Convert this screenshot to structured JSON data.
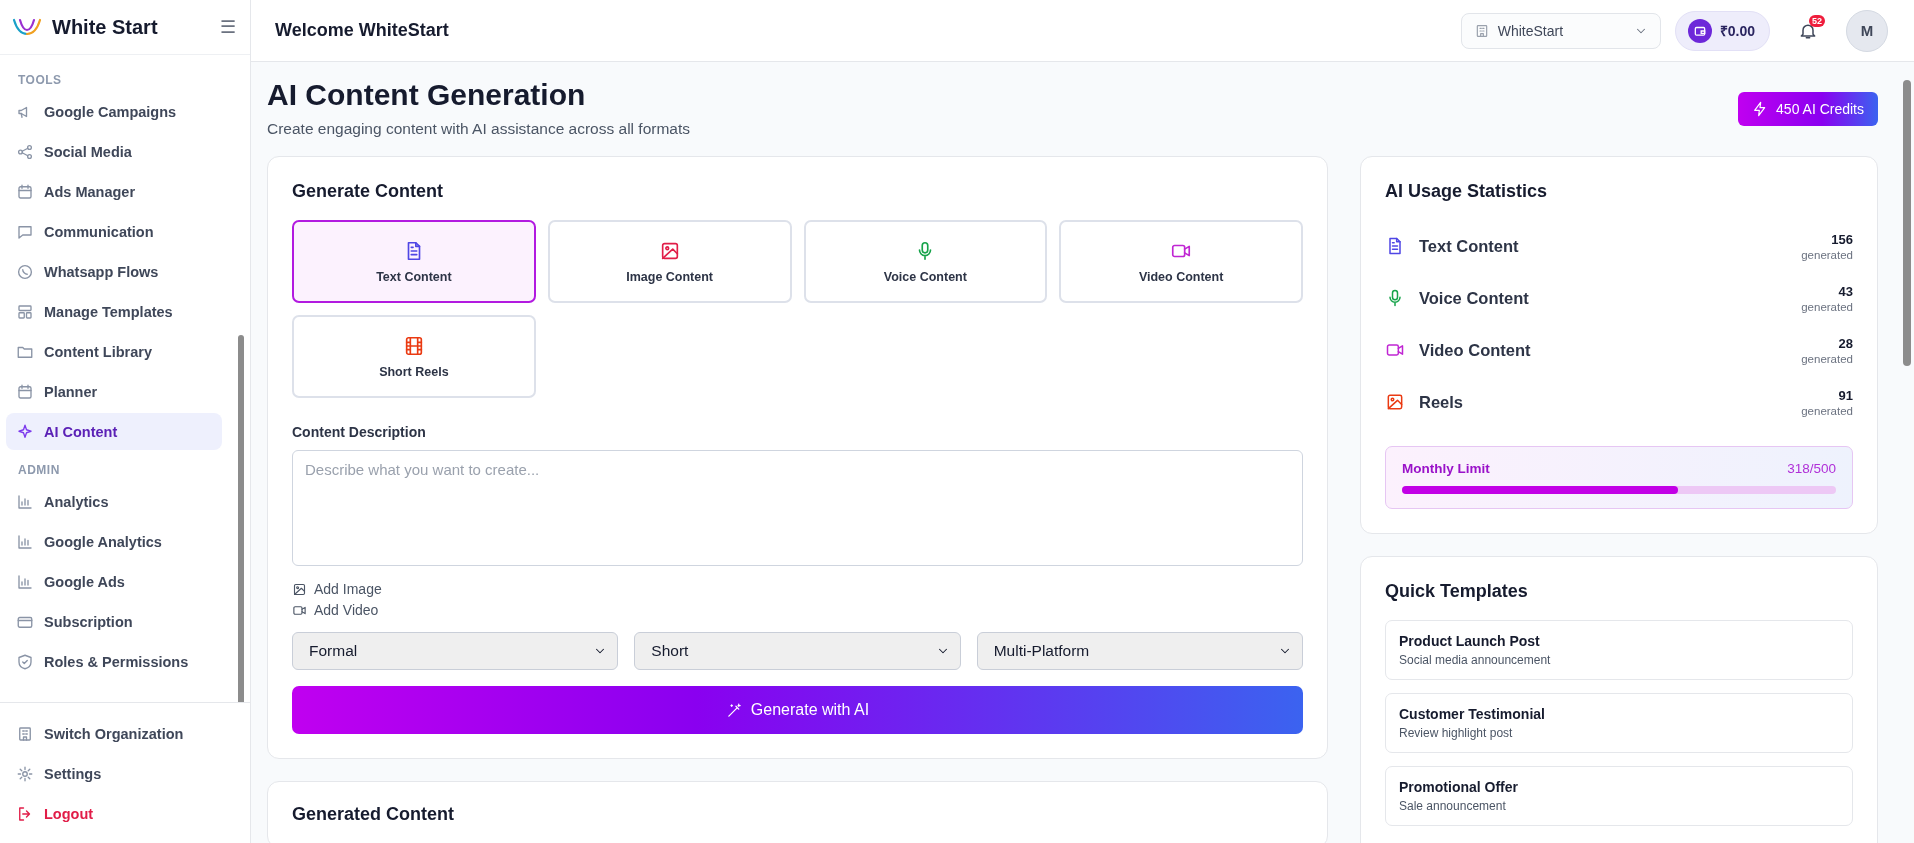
{
  "brand": {
    "name": "White Start",
    "menu_glyph": "☰"
  },
  "sidebar": {
    "sections": [
      {
        "heading": "TOOLS",
        "items": [
          {
            "label": "Google Campaigns",
            "selected": false
          },
          {
            "label": "Social Media",
            "selected": false
          },
          {
            "label": "Ads Manager",
            "selected": false
          },
          {
            "label": "Communication",
            "selected": false
          },
          {
            "label": "Whatsapp Flows",
            "selected": false
          },
          {
            "label": "Manage Templates",
            "selected": false
          },
          {
            "label": "Content Library",
            "selected": false
          },
          {
            "label": "Planner",
            "selected": false
          },
          {
            "label": "AI Content",
            "selected": true
          }
        ]
      },
      {
        "heading": "ADMIN",
        "items": [
          {
            "label": "Analytics",
            "selected": false
          },
          {
            "label": "Google Analytics",
            "selected": false
          },
          {
            "label": "Google Ads",
            "selected": false
          },
          {
            "label": "Subscription",
            "selected": false
          },
          {
            "label": "Roles & Permissions",
            "selected": false
          }
        ]
      }
    ],
    "footer": [
      {
        "label": "Switch Organization",
        "kind": "normal"
      },
      {
        "label": "Settings",
        "kind": "normal"
      },
      {
        "label": "Logout",
        "kind": "danger"
      }
    ]
  },
  "header": {
    "welcome": "Welcome WhiteStart",
    "organization": "WhiteStart",
    "wallet": "₹0.00",
    "notifications": "52",
    "avatar": "M"
  },
  "page": {
    "title": "AI Content Generation",
    "subtitle": "Create engaging content with AI assistance across all formats",
    "credits": "450 AI Credits"
  },
  "generate": {
    "title": "Generate Content",
    "types": [
      {
        "label": "Text Content",
        "color": "#4f46e5",
        "selected": true
      },
      {
        "label": "Image Content",
        "color": "#e11d48",
        "selected": false
      },
      {
        "label": "Voice Content",
        "color": "#16a34a",
        "selected": false
      },
      {
        "label": "Video Content",
        "color": "#c026d3",
        "selected": false
      },
      {
        "label": "Short Reels",
        "color": "#ea3a12",
        "selected": false
      }
    ],
    "description_label": "Content Description",
    "placeholder": "Describe what you want to create...",
    "attachments": [
      "Add Image",
      "Add Video"
    ],
    "options": [
      "Formal",
      "Short",
      "Multi-Platform"
    ],
    "button": "Generate with AI"
  },
  "generated": {
    "title": "Generated Content"
  },
  "stats": {
    "title": "AI Usage Statistics",
    "items": [
      {
        "label": "Text Content",
        "count": "156",
        "unit": "generated",
        "color": "#4f46e5"
      },
      {
        "label": "Voice Content",
        "count": "43",
        "unit": "generated",
        "color": "#16a34a"
      },
      {
        "label": "Video Content",
        "count": "28",
        "unit": "generated",
        "color": "#c026d3"
      },
      {
        "label": "Reels",
        "count": "91",
        "unit": "generated",
        "color": "#ea3a12"
      }
    ],
    "limit": {
      "label": "Monthly Limit",
      "reading": "318/500",
      "level": 0.636
    }
  },
  "templates": {
    "title": "Quick Templates",
    "items": [
      {
        "title": "Product Launch Post",
        "subtitle": "Social media announcement"
      },
      {
        "title": "Customer Testimonial",
        "subtitle": "Review highlight post"
      },
      {
        "title": "Promotional Offer",
        "subtitle": "Sale announcement"
      }
    ]
  }
}
